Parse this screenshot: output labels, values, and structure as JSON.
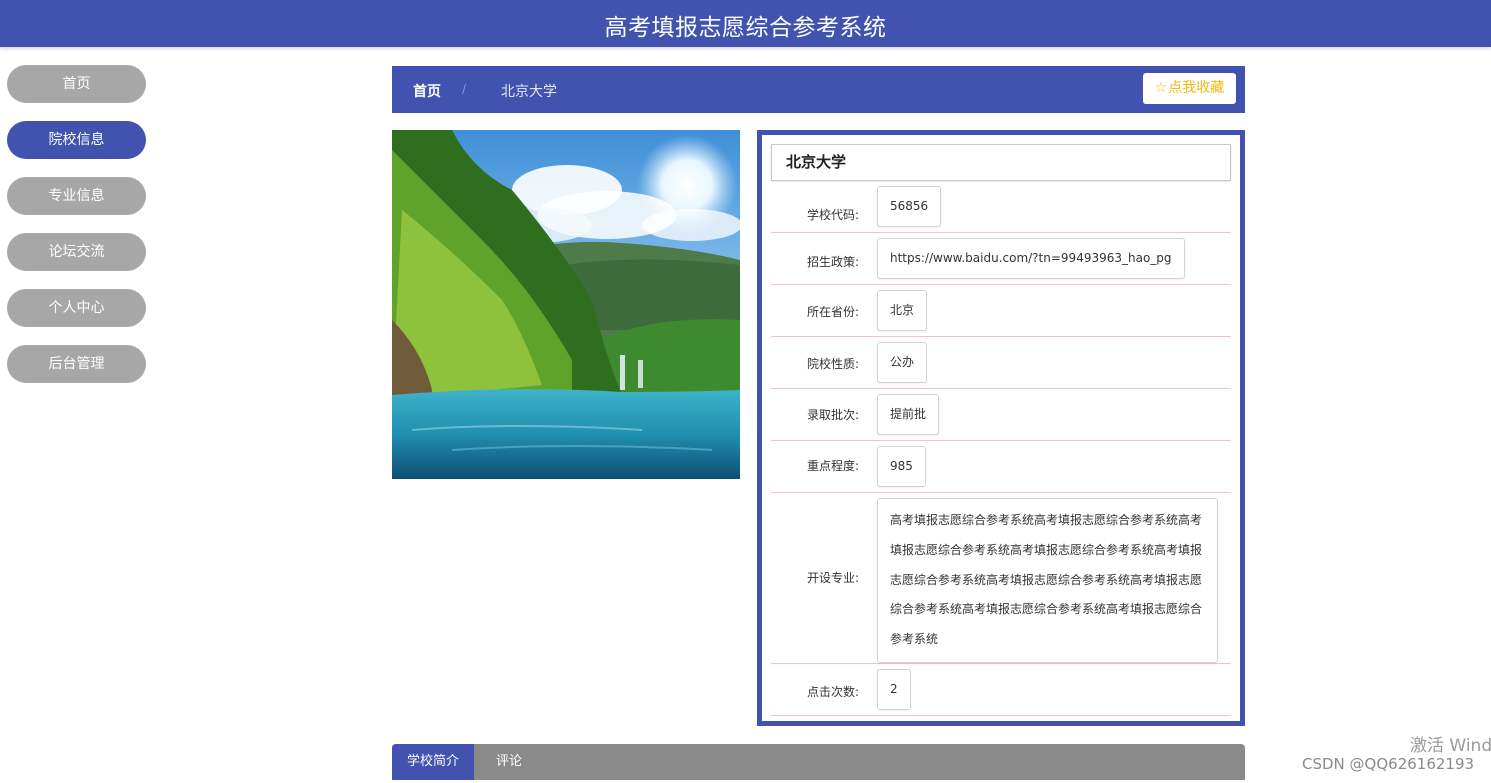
{
  "header": {
    "title": "高考填报志愿综合参考系统"
  },
  "sidebar": {
    "items": [
      {
        "label": "首页",
        "active": false
      },
      {
        "label": "院校信息",
        "active": true
      },
      {
        "label": "专业信息",
        "active": false
      },
      {
        "label": "论坛交流",
        "active": false
      },
      {
        "label": "个人中心",
        "active": false
      },
      {
        "label": "后台管理",
        "active": false
      }
    ]
  },
  "breadcrumb": {
    "home": "首页",
    "separator": "/",
    "current": "北京大学",
    "favorite_label": "点我收藏",
    "favorite_icon": "star-outline-icon"
  },
  "school": {
    "name": "北京大学",
    "fields": [
      {
        "label": "学校代码:",
        "value": "56856"
      },
      {
        "label": "招生政策:",
        "value": "https://www.baidu.com/?tn=99493963_hao_pg"
      },
      {
        "label": "所在省份:",
        "value": "北京"
      },
      {
        "label": "院校性质:",
        "value": "公办"
      },
      {
        "label": "录取批次:",
        "value": "提前批"
      },
      {
        "label": "重点程度:",
        "value": "985"
      },
      {
        "label": "开设专业:",
        "value": "高考填报志愿综合参考系统高考填报志愿综合参考系统高考填报志愿综合参考系统高考填报志愿综合参考系统高考填报志愿综合参考系统高考填报志愿综合参考系统高考填报志愿综合参考系统高考填报志愿综合参考系统高考填报志愿综合参考系统"
      },
      {
        "label": "点击次数:",
        "value": "2"
      }
    ]
  },
  "tabs": [
    {
      "label": "学校简介",
      "active": true
    },
    {
      "label": "评论",
      "active": false
    }
  ],
  "watermark": {
    "windows": "激活 Wind",
    "csdn": "CSDN @QQ626162193"
  },
  "colors": {
    "primary": "#4153ae",
    "sidebar_inactive": "#a7a7a7",
    "favorite": "#f3b90b",
    "row_divider": "#f0c4c4",
    "tab_bar": "#8a8a8a"
  }
}
